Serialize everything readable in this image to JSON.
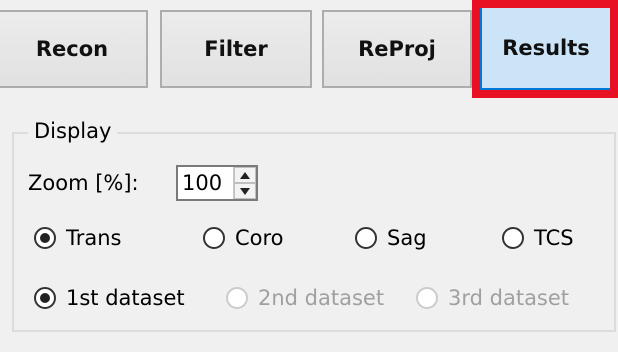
{
  "tabs": [
    {
      "label": "Recon",
      "active": false
    },
    {
      "label": "Filter",
      "active": false
    },
    {
      "label": "ReProj",
      "active": false
    },
    {
      "label": "Results",
      "active": true
    }
  ],
  "display": {
    "group_title": "Display",
    "zoom_label": "Zoom [%]:",
    "zoom_value": "100",
    "view_options": [
      {
        "label": "Trans",
        "checked": true
      },
      {
        "label": "Coro",
        "checked": false
      },
      {
        "label": "Sag",
        "checked": false
      },
      {
        "label": "TCS",
        "checked": false
      }
    ],
    "dataset_options": [
      {
        "label": "1st dataset",
        "checked": true,
        "enabled": true
      },
      {
        "label": "2nd dataset",
        "checked": false,
        "enabled": false
      },
      {
        "label": "3rd dataset",
        "checked": false,
        "enabled": false
      }
    ]
  },
  "colors": {
    "highlight_border": "#e81123",
    "active_tab_bg": "#cce4f7"
  }
}
